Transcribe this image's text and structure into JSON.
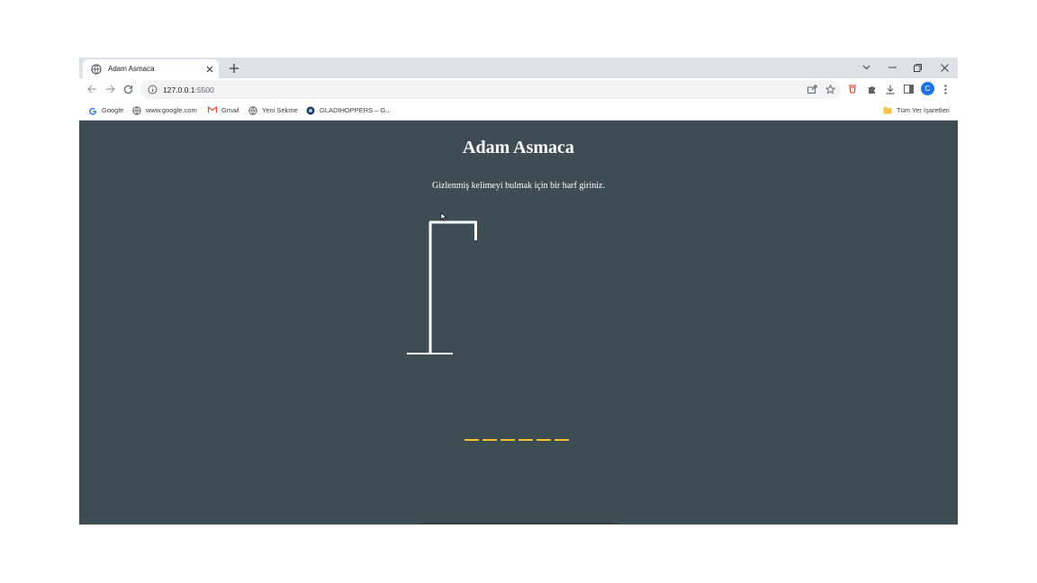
{
  "browser": {
    "tab": {
      "title": "Adam Asmaca"
    },
    "url": {
      "host": "127.0.0.1",
      "port": ":5500"
    },
    "avatar_letter": "C",
    "bookmarks": [
      {
        "label": "Google",
        "icon": "google-icon"
      },
      {
        "label": "www.google.com",
        "icon": "globe-icon"
      },
      {
        "label": "Gmail",
        "icon": "gmail-icon"
      },
      {
        "label": "Yeni Sekme",
        "icon": "globe-icon"
      },
      {
        "label": "GLADIHOPPERS – G...",
        "icon": "gladihoppers-icon"
      }
    ],
    "all_bookmarks_label": "Tüm Yer İşaretleri"
  },
  "page": {
    "title": "Adam Asmaca",
    "instruction": "Gizlenmiş kelimeyi bulmak için bir harf giriniz.",
    "word_length": 6,
    "background": "#3e4c54",
    "slot_color": "#f2c230"
  }
}
